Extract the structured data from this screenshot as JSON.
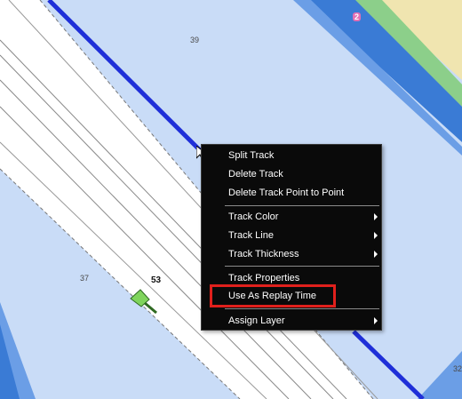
{
  "map": {
    "depth_labels": [
      "39",
      "37",
      "32"
    ],
    "vessel": {
      "label": "53"
    },
    "marker_label": "2",
    "colors": {
      "deep_water": "#c9dcf7",
      "shallow_water": "#6b9ee6",
      "very_shallow": "#3a7bd5",
      "land": "#f0e5b0",
      "vegetation": "#8ccf8a",
      "track": "#1f2fd8",
      "vessel": "#7fd45c"
    }
  },
  "context_menu": {
    "items": [
      {
        "label": "Split Track",
        "has_submenu": false
      },
      {
        "label": "Delete Track",
        "has_submenu": false
      },
      {
        "label": "Delete Track Point to Point",
        "has_submenu": false
      },
      {
        "label": "Track Color",
        "has_submenu": true
      },
      {
        "label": "Track Line",
        "has_submenu": true
      },
      {
        "label": "Track Thickness",
        "has_submenu": true
      },
      {
        "label": "Track Properties",
        "has_submenu": false
      },
      {
        "label": "Use As Replay Time",
        "has_submenu": false,
        "highlighted": true
      },
      {
        "label": "Assign Layer",
        "has_submenu": true
      }
    ]
  },
  "highlight_color": "#e0201c"
}
